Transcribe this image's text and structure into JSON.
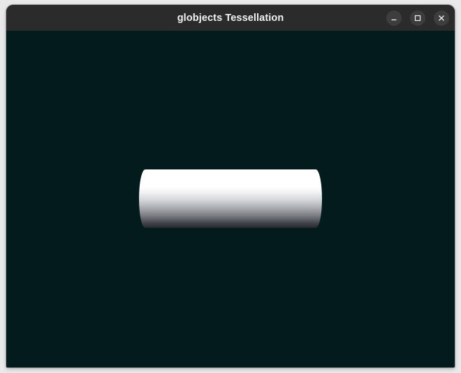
{
  "window": {
    "title": "globjects Tessellation",
    "controls": {
      "minimize_icon": "minimize-icon",
      "maximize_icon": "maximize-icon",
      "close_icon": "close-icon"
    }
  },
  "viewport": {
    "background_color": "#041b1d",
    "object": {
      "shape": "cylinder",
      "top_color": "#ffffff",
      "bottom_color": "#25262d"
    }
  },
  "colors": {
    "titlebar": "#2b2b2b",
    "title_text": "#f2f2f2",
    "control_button": "#3d3d3d"
  }
}
